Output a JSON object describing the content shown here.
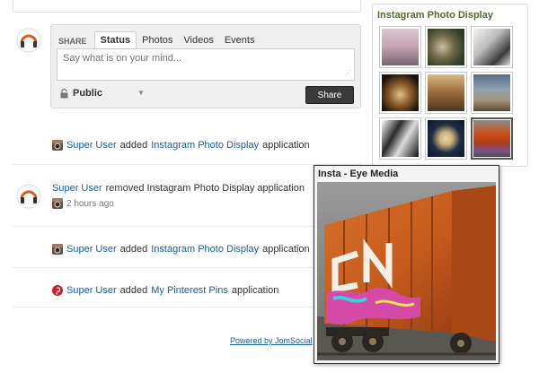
{
  "share": {
    "label": "SHARE",
    "tabs": [
      "Status",
      "Photos",
      "Videos",
      "Events"
    ],
    "active_tab": "Status",
    "placeholder": "Say what is on your mind...",
    "privacy": "Public",
    "share_button": "Share"
  },
  "activities": [
    {
      "user": "Super User",
      "action": "added",
      "app": "Instagram Photo Display",
      "suffix": "application",
      "icon": "instagram-icon"
    },
    {
      "user": "Super User",
      "action": "removed Instagram Photo Display application",
      "time": "2 hours ago",
      "icon": "instagram-icon"
    },
    {
      "user": "Super User",
      "action": "added",
      "app": "Instagram Photo Display",
      "suffix": "application",
      "icon": "instagram-icon"
    },
    {
      "user": "Super User",
      "action": "added",
      "app": "My Pinterest Pins",
      "suffix": "application",
      "icon": "pinterest-icon"
    }
  ],
  "footer": {
    "powered": "Powered by JomSocial"
  },
  "module": {
    "title": "Instagram Photo Display",
    "thumbnail_count": 9,
    "selected_index": 8
  },
  "popup": {
    "title": "Insta - Eye Media"
  },
  "colors": {
    "link": "#1a5fa8",
    "module_title": "#556b2f",
    "share_button": "#3a3a3a"
  }
}
